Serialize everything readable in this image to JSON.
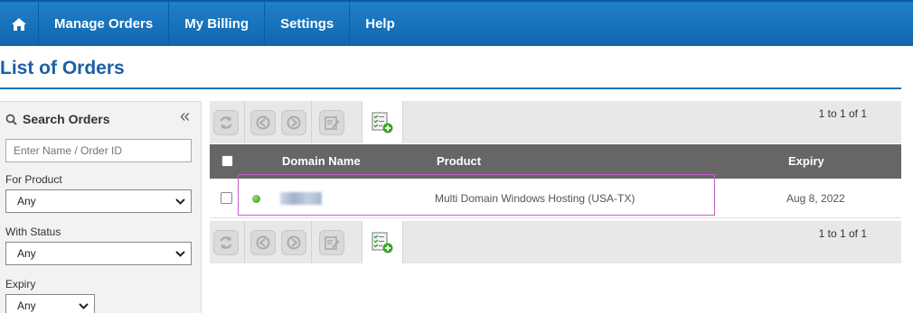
{
  "nav": {
    "home_icon": "home-icon",
    "items": [
      {
        "label": "Manage Orders"
      },
      {
        "label": "My Billing"
      },
      {
        "label": "Settings"
      },
      {
        "label": "Help"
      }
    ]
  },
  "page": {
    "title": "List of Orders"
  },
  "sidebar": {
    "title": "Search Orders",
    "collapse_glyph": "«",
    "search_placeholder": "Enter Name / Order ID",
    "product": {
      "label": "For Product",
      "value": "Any"
    },
    "status": {
      "label": "With Status",
      "value": "Any"
    },
    "expiry": {
      "label": "Expiry",
      "value": "Any"
    }
  },
  "toolbar": {
    "pager_text": "1 to 1 of 1",
    "icons": [
      "refresh-icon",
      "suspend-icon",
      "unsuspend-icon",
      "edit-icon",
      "add-order-icon"
    ]
  },
  "table": {
    "headers": {
      "domain": "Domain Name",
      "product": "Product",
      "expiry": "Expiry"
    },
    "rows": [
      {
        "status": "active",
        "domain": "",
        "product": "Multi Domain Windows Hosting (USA-TX)",
        "expiry": "Aug 8, 2022"
      }
    ]
  },
  "colors": {
    "nav": "#1872bd",
    "title": "#1b5fa7",
    "header": "#666666",
    "highlight": "#c05ec8",
    "status_active": "#3aa624"
  }
}
